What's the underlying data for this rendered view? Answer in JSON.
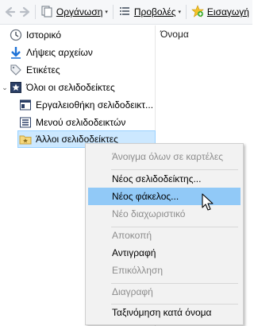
{
  "toolbar": {
    "organize_label": "Οργάνωση",
    "views_label": "Προβολές",
    "import_label": "Εισαγωγή"
  },
  "tree": {
    "items": [
      {
        "label": "Ιστορικό",
        "icon": "history-clock-icon"
      },
      {
        "label": "Λήψεις αρχείων",
        "icon": "download-arrow-icon"
      },
      {
        "label": "Ετικέτες",
        "icon": "tag-icon"
      },
      {
        "label": "Όλοι οι σελιδοδείκτες",
        "icon": "bookmarks-star-icon",
        "expanded": true
      },
      {
        "label": "Εργαλειοθήκη σελιδοδεικτ...",
        "icon": "toolbar-bookmark-icon"
      },
      {
        "label": "Μενού σελιδοδεικτών",
        "icon": "bookmarks-menu-icon"
      },
      {
        "label": "Άλλοι σελιδοδείκτες",
        "icon": "folder-star-icon",
        "selected": true
      }
    ]
  },
  "list": {
    "column_name": "Όνομα"
  },
  "context_menu": {
    "items": [
      {
        "label": "Άνοιγμα όλων σε καρτέλες",
        "disabled": true
      },
      {
        "label": "Νέος σελιδοδείκτης...",
        "disabled": false
      },
      {
        "label": "Νέος φάκελος...",
        "disabled": false,
        "hovered": true
      },
      {
        "label": "Νέο διαχωριστικό",
        "disabled": true
      },
      {
        "label": "Αποκοπή",
        "disabled": true
      },
      {
        "label": "Αντιγραφή",
        "disabled": false
      },
      {
        "label": "Επικόλληση",
        "disabled": true
      },
      {
        "label": "Διαγραφή",
        "disabled": true
      },
      {
        "label": "Ταξινόμηση κατά όνομα",
        "disabled": false
      }
    ]
  },
  "colors": {
    "selection_bg": "#cce8ff",
    "menu_hover_bg": "#91c9f7",
    "menu_bg": "#f2f2f2"
  }
}
